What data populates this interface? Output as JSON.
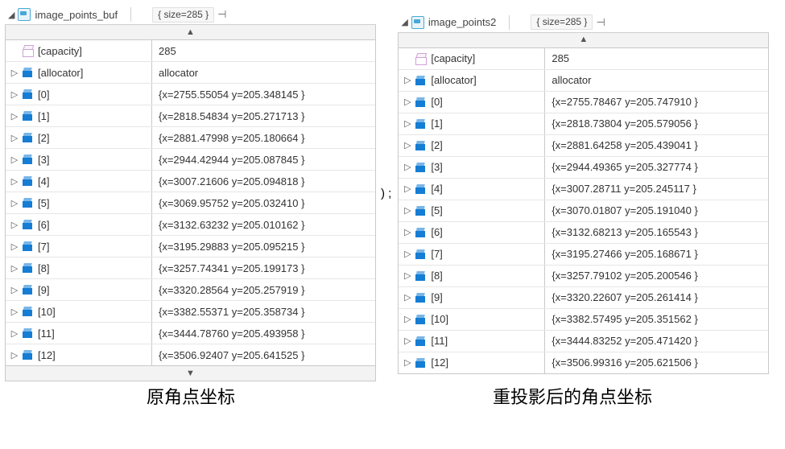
{
  "between_text": ") ;",
  "captions": {
    "left": "原角点坐标",
    "right": "重投影后的角点坐标"
  },
  "panels": [
    {
      "id": "left",
      "title": "image_points_buf",
      "size_label": "{ size=285 }",
      "scroll_up": "▲",
      "scroll_down": "▼",
      "rows": [
        {
          "expand": "",
          "icon": "cube",
          "name": "[capacity]",
          "value": "285"
        },
        {
          "expand": "▷",
          "icon": "blue",
          "name": "[allocator]",
          "value": "allocator"
        },
        {
          "expand": "▷",
          "icon": "blue",
          "name": "[0]",
          "value": "{x=2755.55054 y=205.348145 }"
        },
        {
          "expand": "▷",
          "icon": "blue",
          "name": "[1]",
          "value": "{x=2818.54834 y=205.271713 }"
        },
        {
          "expand": "▷",
          "icon": "blue",
          "name": "[2]",
          "value": "{x=2881.47998 y=205.180664 }"
        },
        {
          "expand": "▷",
          "icon": "blue",
          "name": "[3]",
          "value": "{x=2944.42944 y=205.087845 }"
        },
        {
          "expand": "▷",
          "icon": "blue",
          "name": "[4]",
          "value": "{x=3007.21606 y=205.094818 }"
        },
        {
          "expand": "▷",
          "icon": "blue",
          "name": "[5]",
          "value": "{x=3069.95752 y=205.032410 }"
        },
        {
          "expand": "▷",
          "icon": "blue",
          "name": "[6]",
          "value": "{x=3132.63232 y=205.010162 }"
        },
        {
          "expand": "▷",
          "icon": "blue",
          "name": "[7]",
          "value": "{x=3195.29883 y=205.095215 }"
        },
        {
          "expand": "▷",
          "icon": "blue",
          "name": "[8]",
          "value": "{x=3257.74341 y=205.199173 }"
        },
        {
          "expand": "▷",
          "icon": "blue",
          "name": "[9]",
          "value": "{x=3320.28564 y=205.257919 }"
        },
        {
          "expand": "▷",
          "icon": "blue",
          "name": "[10]",
          "value": "{x=3382.55371 y=205.358734 }"
        },
        {
          "expand": "▷",
          "icon": "blue",
          "name": "[11]",
          "value": "{x=3444.78760 y=205.493958 }"
        },
        {
          "expand": "▷",
          "icon": "blue",
          "name": "[12]",
          "value": "{x=3506.92407 y=205.641525 }"
        }
      ]
    },
    {
      "id": "right",
      "title": "image_points2",
      "size_label": "{ size=285 }",
      "scroll_up": "▲",
      "scroll_down": "",
      "rows": [
        {
          "expand": "",
          "icon": "cube",
          "name": "[capacity]",
          "value": "285"
        },
        {
          "expand": "▷",
          "icon": "blue",
          "name": "[allocator]",
          "value": "allocator"
        },
        {
          "expand": "▷",
          "icon": "blue",
          "name": "[0]",
          "value": "{x=2755.78467 y=205.747910 }"
        },
        {
          "expand": "▷",
          "icon": "blue",
          "name": "[1]",
          "value": "{x=2818.73804 y=205.579056 }"
        },
        {
          "expand": "▷",
          "icon": "blue",
          "name": "[2]",
          "value": "{x=2881.64258 y=205.439041 }"
        },
        {
          "expand": "▷",
          "icon": "blue",
          "name": "[3]",
          "value": "{x=2944.49365 y=205.327774 }"
        },
        {
          "expand": "▷",
          "icon": "blue",
          "name": "[4]",
          "value": "{x=3007.28711 y=205.245117 }"
        },
        {
          "expand": "▷",
          "icon": "blue",
          "name": "[5]",
          "value": "{x=3070.01807 y=205.191040 }"
        },
        {
          "expand": "▷",
          "icon": "blue",
          "name": "[6]",
          "value": "{x=3132.68213 y=205.165543 }"
        },
        {
          "expand": "▷",
          "icon": "blue",
          "name": "[7]",
          "value": "{x=3195.27466 y=205.168671 }"
        },
        {
          "expand": "▷",
          "icon": "blue",
          "name": "[8]",
          "value": "{x=3257.79102 y=205.200546 }"
        },
        {
          "expand": "▷",
          "icon": "blue",
          "name": "[9]",
          "value": "{x=3320.22607 y=205.261414 }"
        },
        {
          "expand": "▷",
          "icon": "blue",
          "name": "[10]",
          "value": "{x=3382.57495 y=205.351562 }"
        },
        {
          "expand": "▷",
          "icon": "blue",
          "name": "[11]",
          "value": "{x=3444.83252 y=205.471420 }"
        },
        {
          "expand": "▷",
          "icon": "blue",
          "name": "[12]",
          "value": "{x=3506.99316 y=205.621506 }"
        }
      ]
    }
  ]
}
